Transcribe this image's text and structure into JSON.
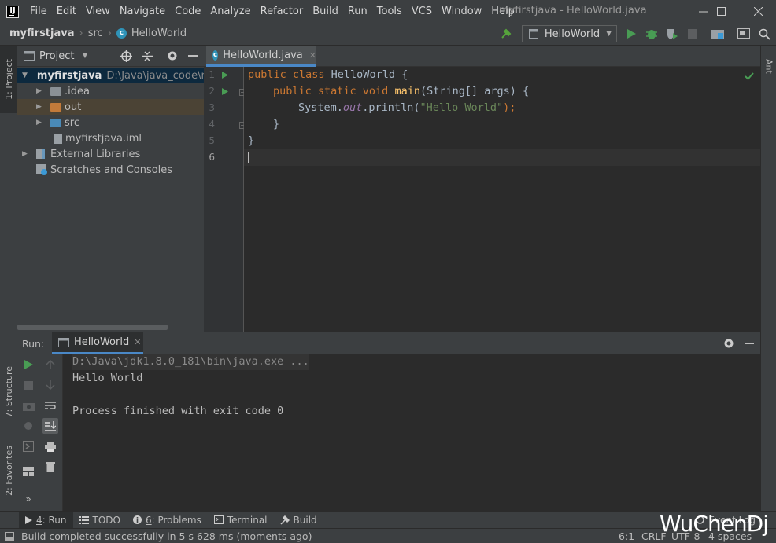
{
  "window": {
    "title": "myfirstjava - HelloWorld.java",
    "app_icon": "intellij-logo",
    "logo_letter": "IJ"
  },
  "menu": [
    "File",
    "Edit",
    "View",
    "Navigate",
    "Code",
    "Analyze",
    "Refactor",
    "Build",
    "Run",
    "Tools",
    "VCS",
    "Window",
    "Help"
  ],
  "breadcrumb": {
    "project": "myfirstjava",
    "folder": "src",
    "file": "HelloWorld"
  },
  "toolbar": {
    "run_config": "HelloWorld"
  },
  "left_strip": {
    "project_tab": "1: Project",
    "structure_tab": "7: Structure",
    "favorites_tab": "2: Favorites"
  },
  "right_strip": {
    "ant_tab": "Ant"
  },
  "project_panel": {
    "title": "Project",
    "tree": [
      {
        "label": "myfirstjava",
        "path": "D:\\Java\\java_code\\m"
      },
      {
        "label": ".idea"
      },
      {
        "label": "out"
      },
      {
        "label": "src"
      },
      {
        "label": "myfirstjava.iml"
      },
      {
        "label": "External Libraries"
      },
      {
        "label": "Scratches and Consoles"
      }
    ]
  },
  "editor": {
    "tab_label": "HelloWorld.java",
    "line_numbers": [
      "1",
      "2",
      "3",
      "4",
      "5",
      "6"
    ],
    "lines": [
      {
        "kw": "public class ",
        "name": "HelloWorld",
        "rest": " {"
      },
      {
        "kw": "public static void ",
        "fn": "main",
        "rest": "(String[] args) {"
      },
      {
        "pre": "System.",
        "field": "out",
        "mid": ".println(",
        "str": "\"Hello World\"",
        "post": ");"
      },
      {
        "text": "}"
      },
      {
        "text": "}"
      },
      {
        "text": ""
      }
    ]
  },
  "run_panel": {
    "label": "Run:",
    "tab_label": "HelloWorld",
    "console": [
      "D:\\Java\\jdk1.8.0_181\\bin\\java.exe ...",
      "Hello World",
      "",
      "Process finished with exit code 0"
    ]
  },
  "bottom_tabs": [
    {
      "num": "4",
      "label": ": Run"
    },
    {
      "label": "TODO"
    },
    {
      "num": "6",
      "label": ": Problems"
    },
    {
      "label": "Terminal"
    },
    {
      "label": "Build"
    },
    {
      "label": "Event Log"
    }
  ],
  "status": {
    "message": "Build completed successfully in 5 s 628 ms (moments ago)",
    "position": "6:1",
    "line_sep": "CRLF",
    "encoding": "UTF-8",
    "indent": "4 spaces"
  },
  "watermark": "WuChenDj",
  "colors": {
    "accent": "#4a88c7",
    "run_green": "#499c54",
    "keyword": "#cc7832",
    "string": "#6a8759"
  }
}
